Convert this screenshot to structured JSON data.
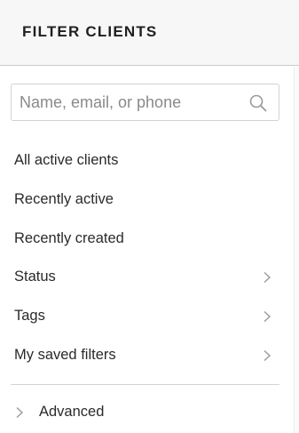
{
  "header": {
    "title": "FILTER CLIENTS"
  },
  "search": {
    "placeholder": "Name, email, or phone",
    "value": "",
    "icon": "search-icon"
  },
  "filters": [
    {
      "label": "All active clients",
      "has_submenu": false
    },
    {
      "label": "Recently active",
      "has_submenu": false
    },
    {
      "label": "Recently created",
      "has_submenu": false
    },
    {
      "label": "Status",
      "has_submenu": true,
      "icon": "chevron-right-icon"
    },
    {
      "label": "Tags",
      "has_submenu": true,
      "icon": "chevron-right-icon"
    },
    {
      "label": "My saved filters",
      "has_submenu": true,
      "icon": "chevron-right-icon"
    }
  ],
  "advanced": {
    "label": "Advanced",
    "icon": "chevron-right-icon",
    "expanded": false
  },
  "colors": {
    "text": "#2a2a2a",
    "header_bg": "#f7f7f7",
    "border": "#d2d2d2",
    "icon": "#9a9a9a"
  }
}
